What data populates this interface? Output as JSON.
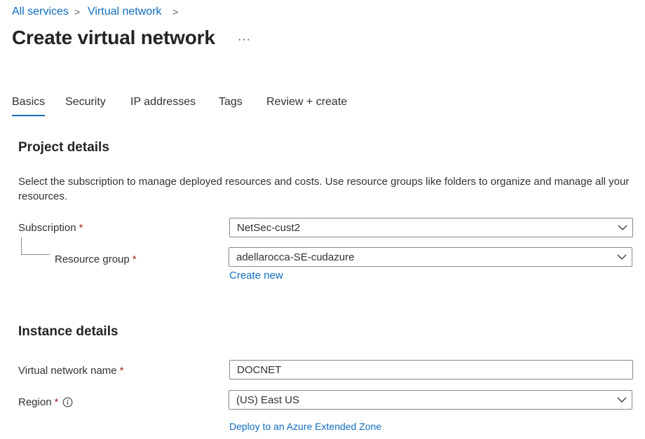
{
  "breadcrumb": {
    "items": [
      {
        "label": "All services"
      },
      {
        "label": "Virtual network"
      }
    ],
    "separator": ">"
  },
  "page": {
    "title": "Create virtual network",
    "more_label": "···"
  },
  "tabs": [
    {
      "label": "Basics",
      "active": true
    },
    {
      "label": "Security",
      "active": false
    },
    {
      "label": "IP addresses",
      "active": false
    },
    {
      "label": "Tags",
      "active": false
    },
    {
      "label": "Review + create",
      "active": false
    }
  ],
  "project_details": {
    "title": "Project details",
    "description": "Select the subscription to manage deployed resources and costs. Use resource groups like folders to organize and manage all your resources.",
    "subscription": {
      "label": "Subscription",
      "required_marker": "*",
      "value": "NetSec-cust2"
    },
    "resource_group": {
      "label": "Resource group",
      "required_marker": "*",
      "value": "adellarocca-SE-cudazure",
      "create_new_label": "Create new"
    }
  },
  "instance_details": {
    "title": "Instance details",
    "vnet_name": {
      "label": "Virtual network name",
      "required_marker": "*",
      "value": "DOCNET"
    },
    "region": {
      "label": "Region",
      "required_marker": "*",
      "info_icon": "info-icon",
      "value": "(US) East US",
      "extended_zone_label": "Deploy to an Azure Extended Zone"
    }
  },
  "colors": {
    "link": "#0f6cbd",
    "required": "#a4262c",
    "border": "#8a8886",
    "text": "#323130"
  }
}
